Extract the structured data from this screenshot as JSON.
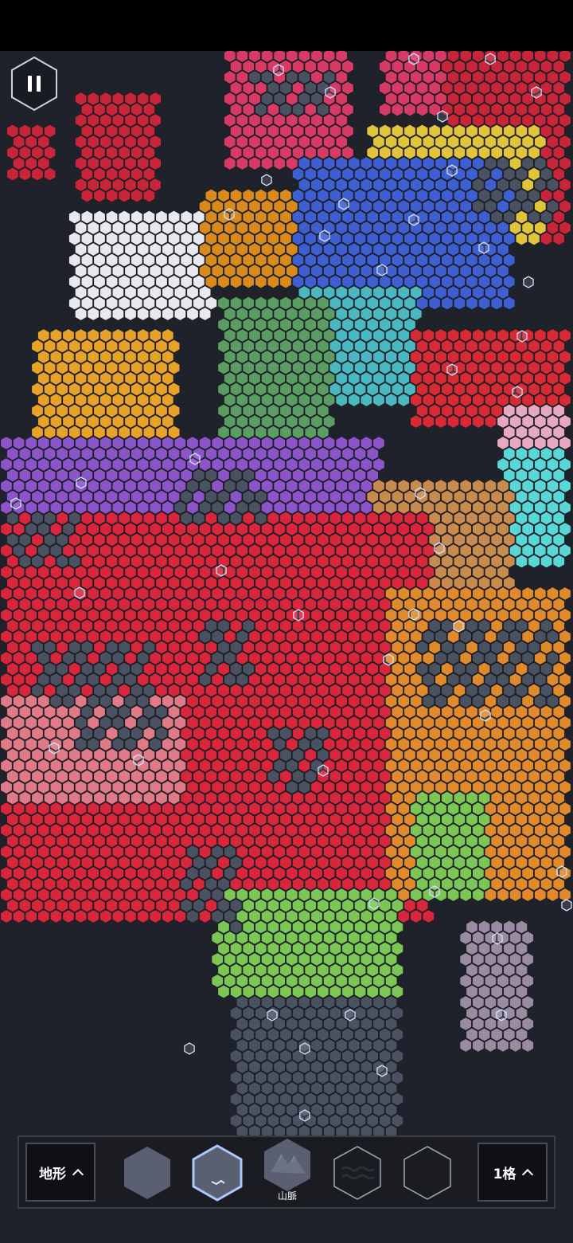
{
  "toolbar": {
    "terrain_select_label": "地形",
    "size_select_label": "1格",
    "tiles": [
      {
        "name": "plain-tile",
        "label": "",
        "selected": false
      },
      {
        "name": "plain-alt-tile",
        "label": "",
        "selected": true
      },
      {
        "name": "mountain-tile",
        "label": "山脈",
        "selected": false
      },
      {
        "name": "water-tile",
        "label": "",
        "selected": false
      },
      {
        "name": "empty-tile",
        "label": "",
        "selected": false
      }
    ]
  },
  "icons": {
    "pause": "pause-icon",
    "terrain_chevron": "chevron-up-icon",
    "size_chevron": "chevron-up-icon"
  },
  "colors": {
    "background": "#20222b",
    "neutral_land": "#4a5160",
    "selected_outline": "#a9c8ff",
    "united_kingdom": "#c8243a",
    "france": "#e8e8ee",
    "germany": "#d88a1c",
    "italy": "#5a9c62",
    "spain": "#e8a22a",
    "poland": "#d83a66",
    "ukraine": "#e0c43a",
    "russia": "#3d5fcf",
    "balkans": "#4ab8c0",
    "turkey": "#d62a34",
    "morocco": "#8b54c9",
    "egypt": "#c98a4e",
    "arabia": "#59d6d6",
    "north_africa": "#d8263c",
    "east_africa": "#e08a2c",
    "central_africa": "#7cc656",
    "west_africa": "#e07a86",
    "madagascar": "#9a8aa2",
    "levant": "#e8a8c0"
  }
}
